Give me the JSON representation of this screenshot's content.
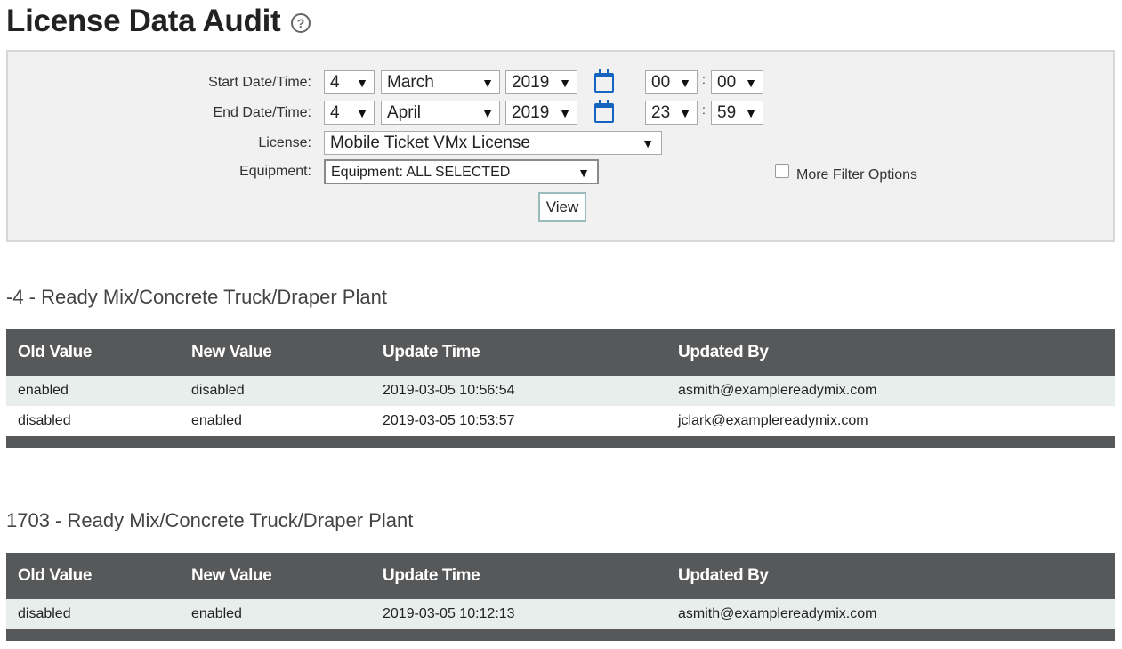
{
  "page": {
    "title": "License Data Audit",
    "help_icon": "question-circle-icon"
  },
  "filters": {
    "start_label": "Start Date/Time:",
    "end_label": "End Date/Time:",
    "license_label": "License:",
    "equipment_label": "Equipment:",
    "start": {
      "day": "4",
      "month": "March",
      "year": "2019",
      "hour": "00",
      "minute": "00"
    },
    "end": {
      "day": "4",
      "month": "April",
      "year": "2019",
      "hour": "23",
      "minute": "59"
    },
    "license_value": "Mobile Ticket VMx License",
    "equipment_value": "Equipment: ALL SELECTED",
    "more_filter_label": "More Filter Options",
    "view_label": "View",
    "colon": ":",
    "arrow": "▼"
  },
  "tables": [
    {
      "title": "-4 - Ready Mix/Concrete Truck/Draper Plant",
      "headers": [
        "Old Value",
        "New Value",
        "Update Time",
        "Updated By"
      ],
      "rows": [
        [
          "enabled",
          "disabled",
          "2019-03-05 10:56:54",
          "asmith@examplereadymix.com"
        ],
        [
          "disabled",
          "enabled",
          "2019-03-05 10:53:57",
          "jclark@examplereadymix.com"
        ]
      ]
    },
    {
      "title": "1703 - Ready Mix/Concrete Truck/Draper Plant",
      "headers": [
        "Old Value",
        "New Value",
        "Update Time",
        "Updated By"
      ],
      "rows": [
        [
          "disabled",
          "enabled",
          "2019-03-05 10:12:13",
          "asmith@examplereadymix.com"
        ]
      ]
    }
  ]
}
